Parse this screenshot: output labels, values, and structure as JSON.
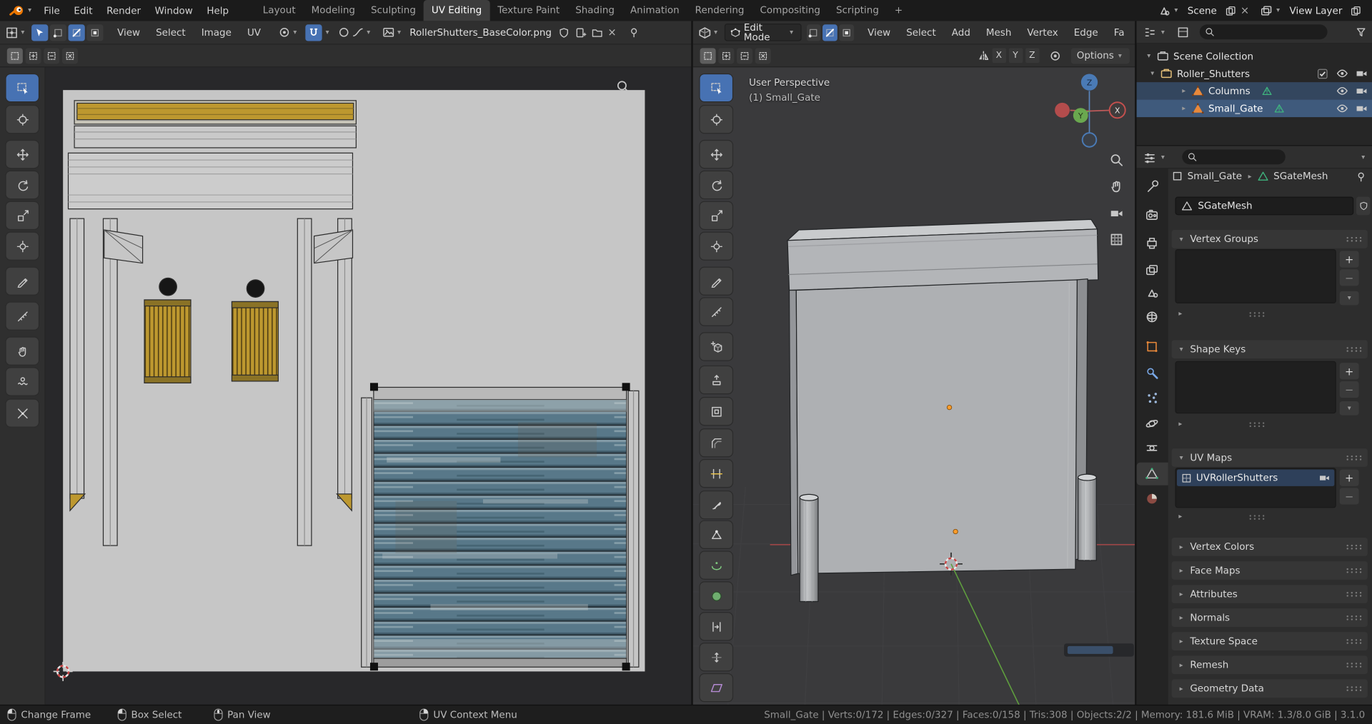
{
  "colors": {
    "accent": "#4772b3",
    "object_orange": "#e8883a",
    "mesh_green": "#3fb57e",
    "gold": "#bd982f",
    "shutter_blue": "#577789"
  },
  "topbar": {
    "menus": [
      "File",
      "Edit",
      "Render",
      "Window",
      "Help"
    ],
    "tabs": [
      "Layout",
      "Modeling",
      "Sculpting",
      "UV Editing",
      "Texture Paint",
      "Shading",
      "Animation",
      "Rendering",
      "Compositing",
      "Scripting"
    ],
    "add_tab": "+",
    "scene_label": "Scene",
    "view_layer_label": "View Layer"
  },
  "uv_editor": {
    "menus": [
      "View",
      "Select",
      "Image",
      "UV"
    ],
    "image_name": "RollerShutters_BaseColor.png",
    "tools": [
      "select-box",
      "cursor",
      "move",
      "rotate",
      "scale",
      "transform",
      "annotate",
      "measure",
      "grab",
      "relax",
      "pinch"
    ]
  },
  "viewport": {
    "mode_label": "Edit Mode",
    "menus": [
      "View",
      "Select",
      "Add",
      "Mesh",
      "Vertex",
      "Edge",
      "Fa"
    ],
    "mirror": [
      "X",
      "Y",
      "Z"
    ],
    "options_label": "Options",
    "overlay": {
      "perspective": "User Perspective",
      "object": "(1) Small_Gate"
    },
    "gizmo": {
      "z": "Z",
      "y": "Y",
      "x": "X"
    },
    "tools": [
      "select-box",
      "cursor",
      "move",
      "rotate",
      "scale",
      "transform",
      "annotate",
      "measure",
      "add-cube",
      "extrude-region",
      "inset-faces",
      "bevel",
      "loop-cut",
      "knife",
      "poly-build",
      "spin",
      "smooth",
      "edge-slide",
      "shrink-fatten",
      "shear"
    ]
  },
  "outliner": {
    "rows": [
      {
        "label": "Scene Collection"
      },
      {
        "label": "Roller_Shutters"
      },
      {
        "label": "Columns"
      },
      {
        "label": "Small_Gate"
      }
    ]
  },
  "properties": {
    "breadcrumb": {
      "object": "Small_Gate",
      "data": "SGateMesh"
    },
    "name_field": "SGateMesh",
    "panels": {
      "vertex_groups": "Vertex Groups",
      "shape_keys": "Shape Keys",
      "uv_maps": "UV Maps",
      "vertex_colors": "Vertex Colors",
      "face_maps": "Face Maps",
      "attributes": "Attributes",
      "normals": "Normals",
      "texture_space": "Texture Space",
      "remesh": "Remesh",
      "geometry_data": "Geometry Data"
    },
    "uv_map_items": [
      "UVRollerShutters"
    ]
  },
  "statusbar": {
    "hints": [
      "Change Frame",
      "Box Select",
      "Pan View",
      "UV Context Menu"
    ],
    "stats": "Small_Gate | Verts:0/172 | Edges:0/327 | Faces:0/158 | Tris:308 | Objects:2/2 | Memory: 181.6 MiB | VRAM: 1.3/8.0 GiB | 3.1.0"
  }
}
